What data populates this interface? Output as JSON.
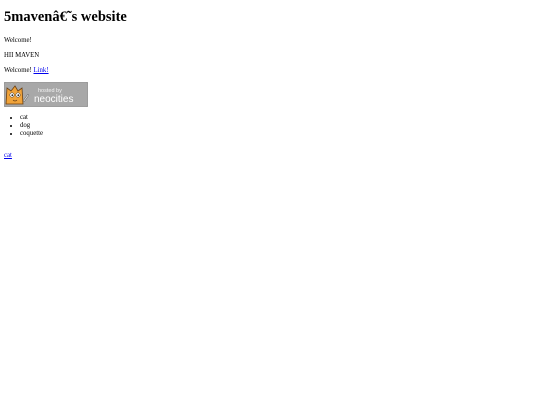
{
  "page": {
    "title": "5mavenâ€˜s website",
    "welcome": "Welcome!",
    "greeting": "HII MAVEN",
    "welcome_prefix": "Welcome!",
    "link_label": "Link!"
  },
  "badge": {
    "text_small": "hosted by",
    "text_large": "neocities",
    "background": "#a8a8a8",
    "icon": "cat-mascot-icon"
  },
  "list": {
    "items": [
      "cat",
      "dog",
      "coquette"
    ]
  },
  "footer": {
    "link_label": "cat"
  },
  "colors": {
    "link": "#0000ee",
    "text": "#000000",
    "background": "#ffffff"
  }
}
